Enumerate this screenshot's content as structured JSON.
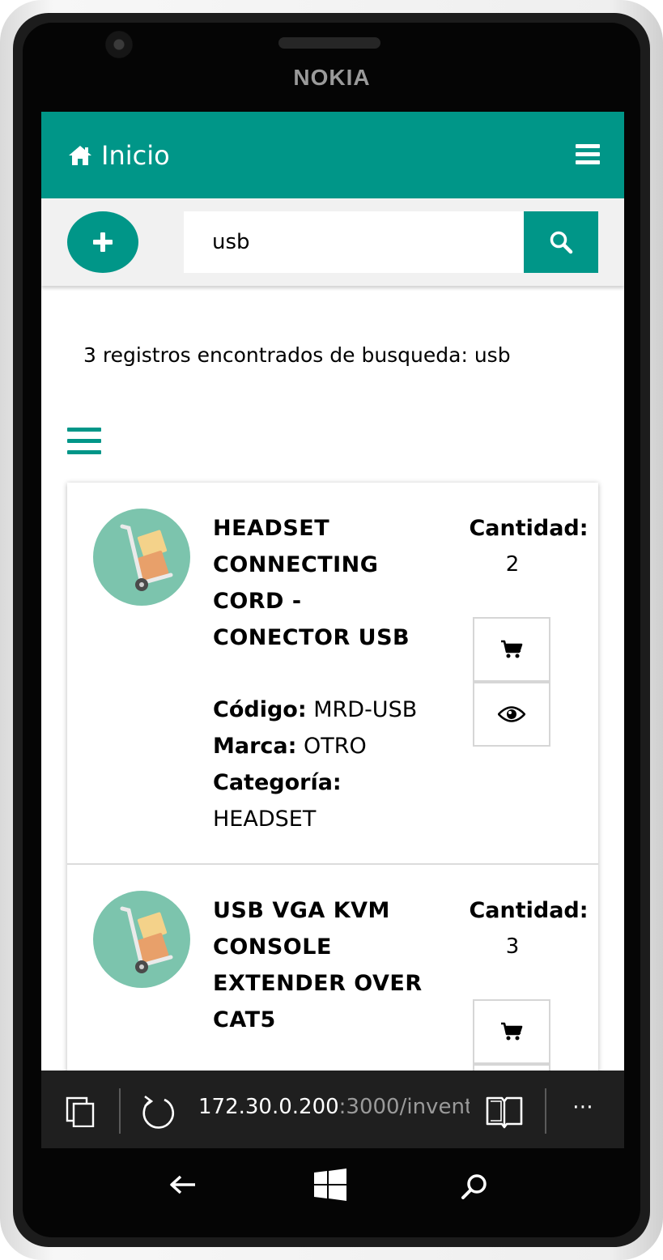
{
  "device": {
    "brand": "NOKIA"
  },
  "navbar": {
    "title": "Inicio"
  },
  "search": {
    "value": "usb"
  },
  "results": {
    "summary": "3 registros encontrados de busqueda: usb"
  },
  "items": [
    {
      "title_lines": [
        "HEADSET",
        "CONNECTING",
        "CORD -",
        "CONECTOR USB"
      ],
      "quantity_label": "Cantidad:",
      "quantity": "2",
      "codigo_label": "Código:",
      "codigo": "MRD-USB",
      "marca_label": "Marca:",
      "marca": "OTRO",
      "categoria_label": "Categoría:",
      "categoria": "HEADSET"
    },
    {
      "title_lines": [
        "USB VGA KVM",
        "CONSOLE",
        "EXTENDER OVER",
        "CAT5"
      ],
      "quantity_label": "Cantidad:",
      "quantity": "3"
    }
  ],
  "browser": {
    "url_host": "172.30.0.200",
    "url_rest": ":3000/invent",
    "more": "⋯"
  },
  "colors": {
    "accent": "#009688",
    "avatar_bg": "#7cc4ad"
  },
  "icons": {
    "nav": "home-icon",
    "menu": "hamburger-menu-icon",
    "add": "plus-icon",
    "search": "search-icon",
    "cart": "shopping-cart-icon",
    "view": "eye-icon"
  }
}
